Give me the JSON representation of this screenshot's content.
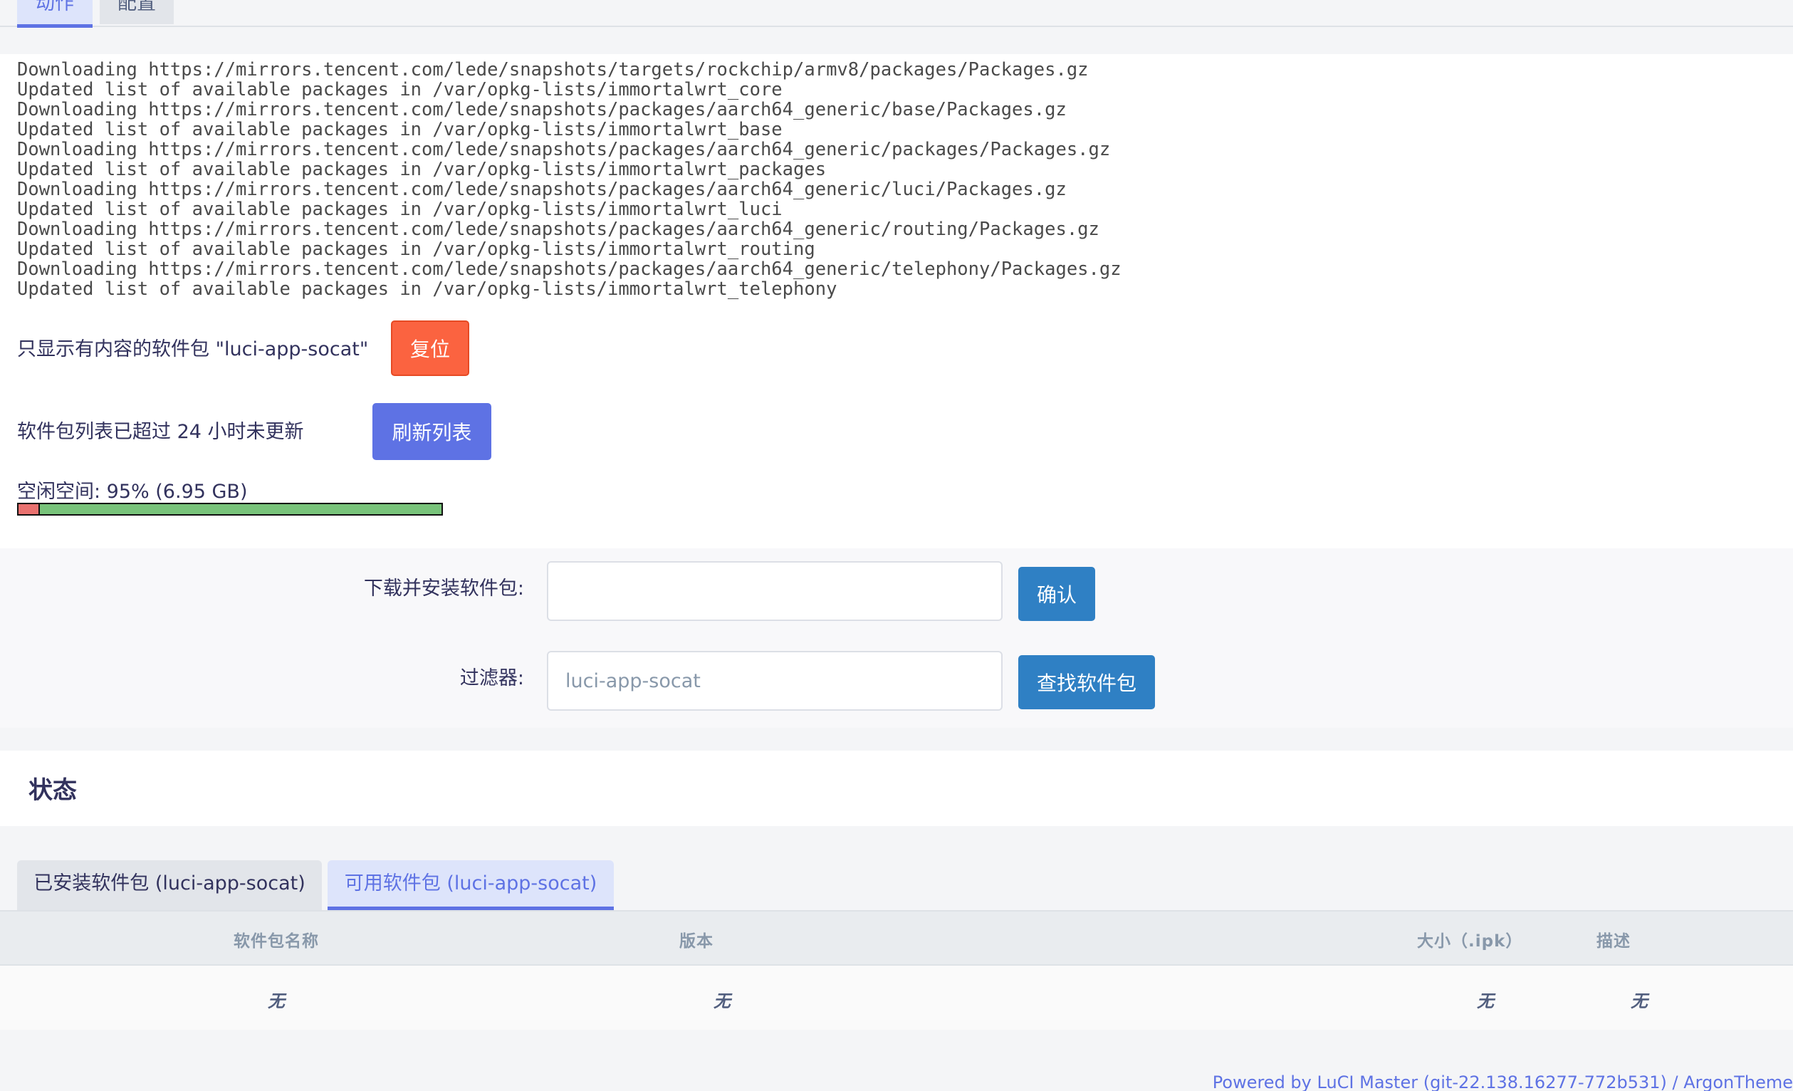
{
  "top_tabs": {
    "actions": "动作",
    "config": "配置"
  },
  "log_lines": [
    "Downloading https://mirrors.tencent.com/lede/snapshots/targets/rockchip/armv8/packages/Packages.gz",
    "Updated list of available packages in /var/opkg-lists/immortalwrt_core",
    "Downloading https://mirrors.tencent.com/lede/snapshots/packages/aarch64_generic/base/Packages.gz",
    "Updated list of available packages in /var/opkg-lists/immortalwrt_base",
    "Downloading https://mirrors.tencent.com/lede/snapshots/packages/aarch64_generic/packages/Packages.gz",
    "Updated list of available packages in /var/opkg-lists/immortalwrt_packages",
    "Downloading https://mirrors.tencent.com/lede/snapshots/packages/aarch64_generic/luci/Packages.gz",
    "Updated list of available packages in /var/opkg-lists/immortalwrt_luci",
    "Downloading https://mirrors.tencent.com/lede/snapshots/packages/aarch64_generic/routing/Packages.gz",
    "Updated list of available packages in /var/opkg-lists/immortalwrt_routing",
    "Downloading https://mirrors.tencent.com/lede/snapshots/packages/aarch64_generic/telephony/Packages.gz",
    "Updated list of available packages in /var/opkg-lists/immortalwrt_telephony"
  ],
  "filter_notice": {
    "text": "只显示有内容的软件包 \"luci-app-socat\"",
    "reset_label": "复位"
  },
  "update_notice": {
    "text": "软件包列表已超过 24 小时未更新",
    "refresh_label": "刷新列表"
  },
  "disk": {
    "label": "空闲空间: 95% (6.95 GB)",
    "used_fraction": 0.05,
    "used_color": "#e9716f",
    "free_color": "#78c37a"
  },
  "install_form": {
    "label": "下载并安装软件包:",
    "value": "",
    "confirm_label": "确认"
  },
  "filter_form": {
    "label": "过滤器:",
    "value": "luci-app-socat",
    "find_label": "查找软件包"
  },
  "status": {
    "title": "状态"
  },
  "sub_tabs": {
    "installed": "已安装软件包 (luci-app-socat)",
    "available": "可用软件包 (luci-app-socat)"
  },
  "table": {
    "headers": {
      "name": "软件包名称",
      "version": "版本",
      "size": "大小（.ipk）",
      "description": "描述"
    },
    "empty_row": {
      "name": "无",
      "version": "无",
      "size": "无",
      "description": "无"
    }
  },
  "footer": {
    "text": "Powered by LuCI Master (git-22.138.16277-772b531) / ArgonTheme"
  },
  "colors": {
    "primary": "#5e72e4",
    "warning": "#fb6340",
    "info": "#2f80c4"
  }
}
